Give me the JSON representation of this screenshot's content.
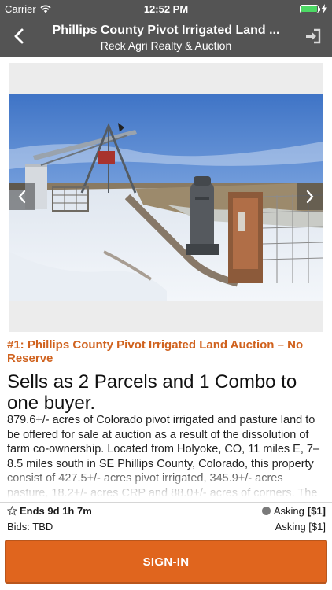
{
  "status_bar": {
    "carrier": "Carrier",
    "time": "12:52 PM"
  },
  "nav": {
    "title": "Phillips County Pivot Irrigated Land ...",
    "subtitle": "Reck Agri Realty & Auction",
    "back_icon": "chevron-left-icon",
    "login_icon": "sign-in-icon"
  },
  "listing": {
    "lot_title": "#1: Phillips County Pivot Irrigated Land Auction – No Reserve",
    "headline": "Sells as 2 Parcels and 1 Combo to one buyer.",
    "description": "879.6+/- acres of Colorado pivot irrigated and pasture land to be offered for sale at auction as a result of the dissolution of farm co-ownership. Located from Holyoke, CO, 11 miles E, 7–8.5 miles south in SE Phillips County, Colorado, this property consist of 427.5+/- acres pivot irrigated, 345.9+/- acres pasture, 18.2+/- acres CRP and 88.0+/- acres of corners. The"
  },
  "auction": {
    "ends_label": "Ends 9d 1h 7m",
    "asking_label_1": "Asking",
    "asking_value_1": "[$1]",
    "bids_label": "Bids: TBD",
    "asking_label_2": "Asking [$1]"
  },
  "signin_button": "SIGN-IN",
  "colors": {
    "bar_background": "#545454",
    "accent": "#e0651e",
    "lot_title": "#d0621e",
    "battery": "#4cd964"
  }
}
